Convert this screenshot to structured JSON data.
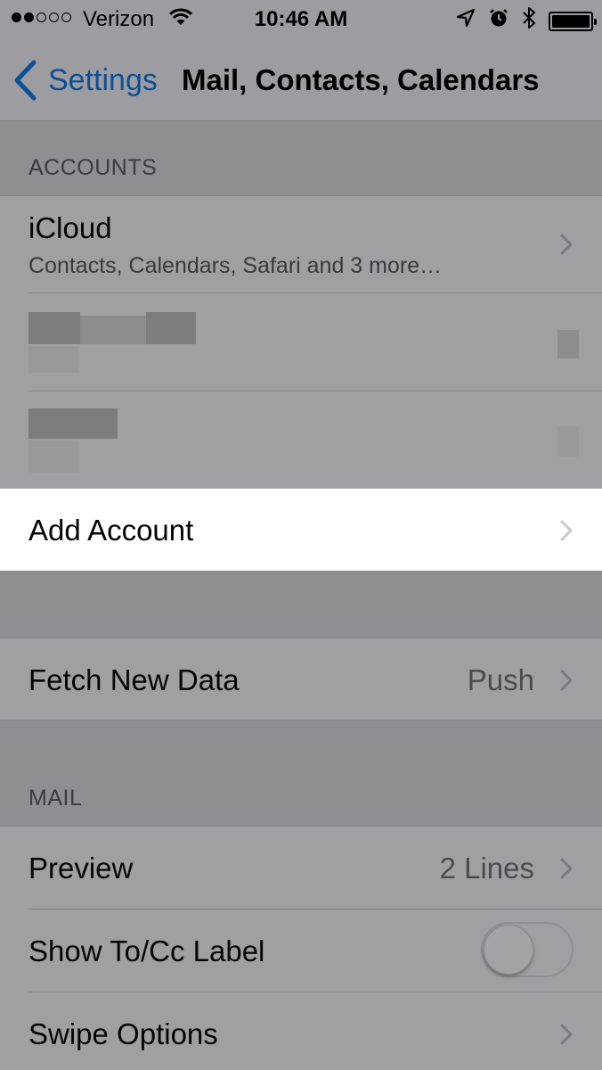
{
  "status_bar": {
    "signal_filled": 2,
    "signal_total": 5,
    "carrier": "Verizon",
    "time": "10:46 AM"
  },
  "nav": {
    "back_label": "Settings",
    "title": "Mail, Contacts, Calendars"
  },
  "accounts_section": {
    "header": "ACCOUNTS",
    "icloud": {
      "title": "iCloud",
      "subtitle": "Contacts, Calendars, Safari and 3 more…"
    },
    "add_account": "Add Account"
  },
  "fetch_section": {
    "label": "Fetch New Data",
    "value": "Push"
  },
  "mail_section": {
    "header": "MAIL",
    "preview": {
      "label": "Preview",
      "value": "2 Lines"
    },
    "show_tocc": {
      "label": "Show To/Cc Label",
      "on": false
    },
    "swipe_options": {
      "label": "Swipe Options"
    }
  },
  "colors": {
    "accent": "#0d4f97",
    "dim_background": "#8f8f92",
    "highlight_row": "#ffffff"
  }
}
